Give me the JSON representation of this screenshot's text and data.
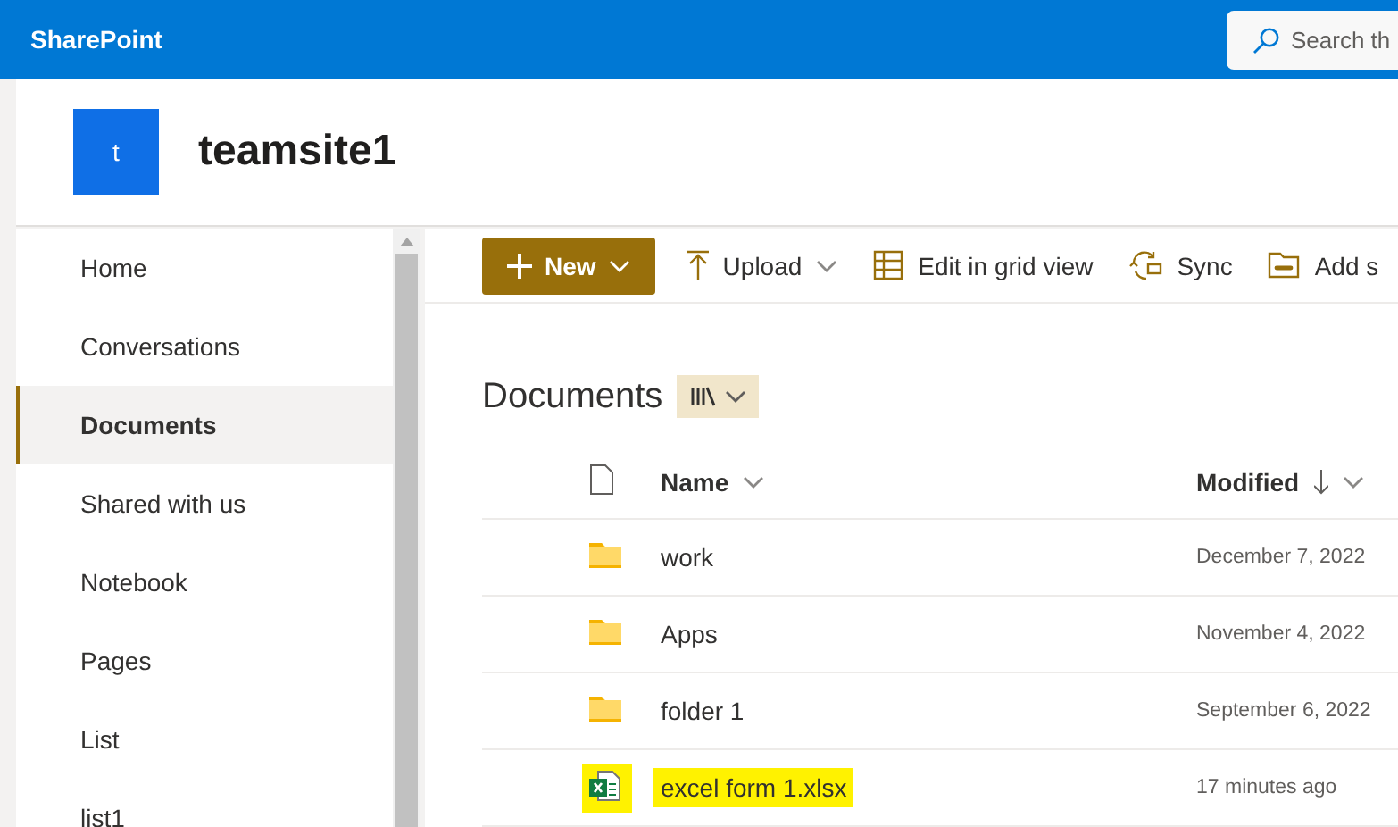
{
  "top_bar": {
    "app_name": "SharePoint",
    "search": {
      "placeholder": "Search th"
    }
  },
  "site": {
    "logo_letter": "t",
    "title": "teamsite1"
  },
  "sidebar": {
    "items": [
      {
        "label": "Home",
        "selected": false
      },
      {
        "label": "Conversations",
        "selected": false
      },
      {
        "label": "Documents",
        "selected": true
      },
      {
        "label": "Shared with us",
        "selected": false
      },
      {
        "label": "Notebook",
        "selected": false
      },
      {
        "label": "Pages",
        "selected": false
      },
      {
        "label": "List",
        "selected": false
      },
      {
        "label": "list1",
        "selected": false
      }
    ]
  },
  "toolbar": {
    "items": [
      {
        "kind": "new",
        "label": "New",
        "menu": true
      },
      {
        "kind": "upload",
        "label": "Upload",
        "menu": true
      },
      {
        "kind": "grid",
        "label": "Edit in grid view",
        "menu": false
      },
      {
        "kind": "sync",
        "label": "Sync",
        "menu": false
      },
      {
        "kind": "shortcut",
        "label": "Add s",
        "menu": false
      }
    ]
  },
  "library": {
    "title": "Documents",
    "columns": [
      {
        "label": "Name",
        "sorted_descending": false
      },
      {
        "label": "Modified",
        "sorted_descending": true
      }
    ],
    "rows": [
      {
        "kind": "folder",
        "name": "work",
        "modified": "December 7, 2022",
        "highlighted": false
      },
      {
        "kind": "folder",
        "name": "Apps",
        "modified": "November 4, 2022",
        "highlighted": false
      },
      {
        "kind": "folder",
        "name": "folder 1",
        "modified": "September 6, 2022",
        "highlighted": false
      },
      {
        "kind": "excel",
        "name": "excel form 1.xlsx",
        "modified": "17 minutes ago",
        "highlighted": true
      }
    ]
  }
}
